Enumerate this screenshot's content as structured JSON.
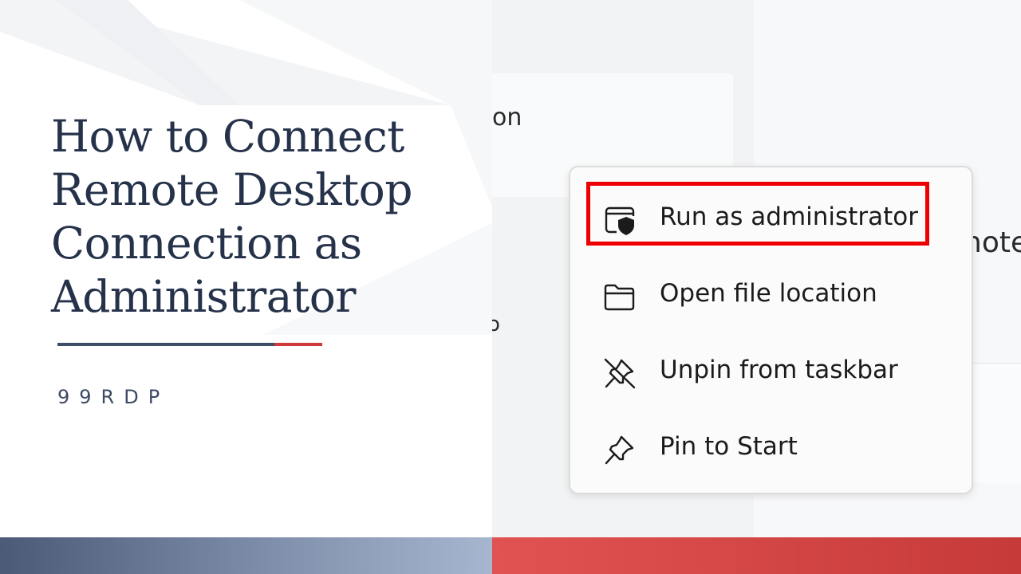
{
  "title": {
    "line1": "How to Connect",
    "line2": "Remote Desktop",
    "line3": "Connection as",
    "line4": "Administrator"
  },
  "brand": "99RDP",
  "background_fragments": {
    "top": "on",
    "right": "note",
    "middle": "o"
  },
  "context_menu": {
    "items": [
      {
        "label": "Run as administrator",
        "icon": "run-as-admin-shield-icon",
        "highlighted": true
      },
      {
        "label": "Open file location",
        "icon": "folder-icon"
      },
      {
        "label": "Unpin from taskbar",
        "icon": "unpin-icon"
      },
      {
        "label": "Pin to Start",
        "icon": "pin-icon"
      }
    ],
    "highlight_color": "#ee0000"
  },
  "colors": {
    "title": "#25324a",
    "accent_navy": "#3e4d68",
    "accent_red": "#cf3b3b",
    "band_left_start": "#4b5a76",
    "band_left_end": "#a7b6cf",
    "band_right_start": "#e15353",
    "band_right_end": "#c73a3a"
  }
}
